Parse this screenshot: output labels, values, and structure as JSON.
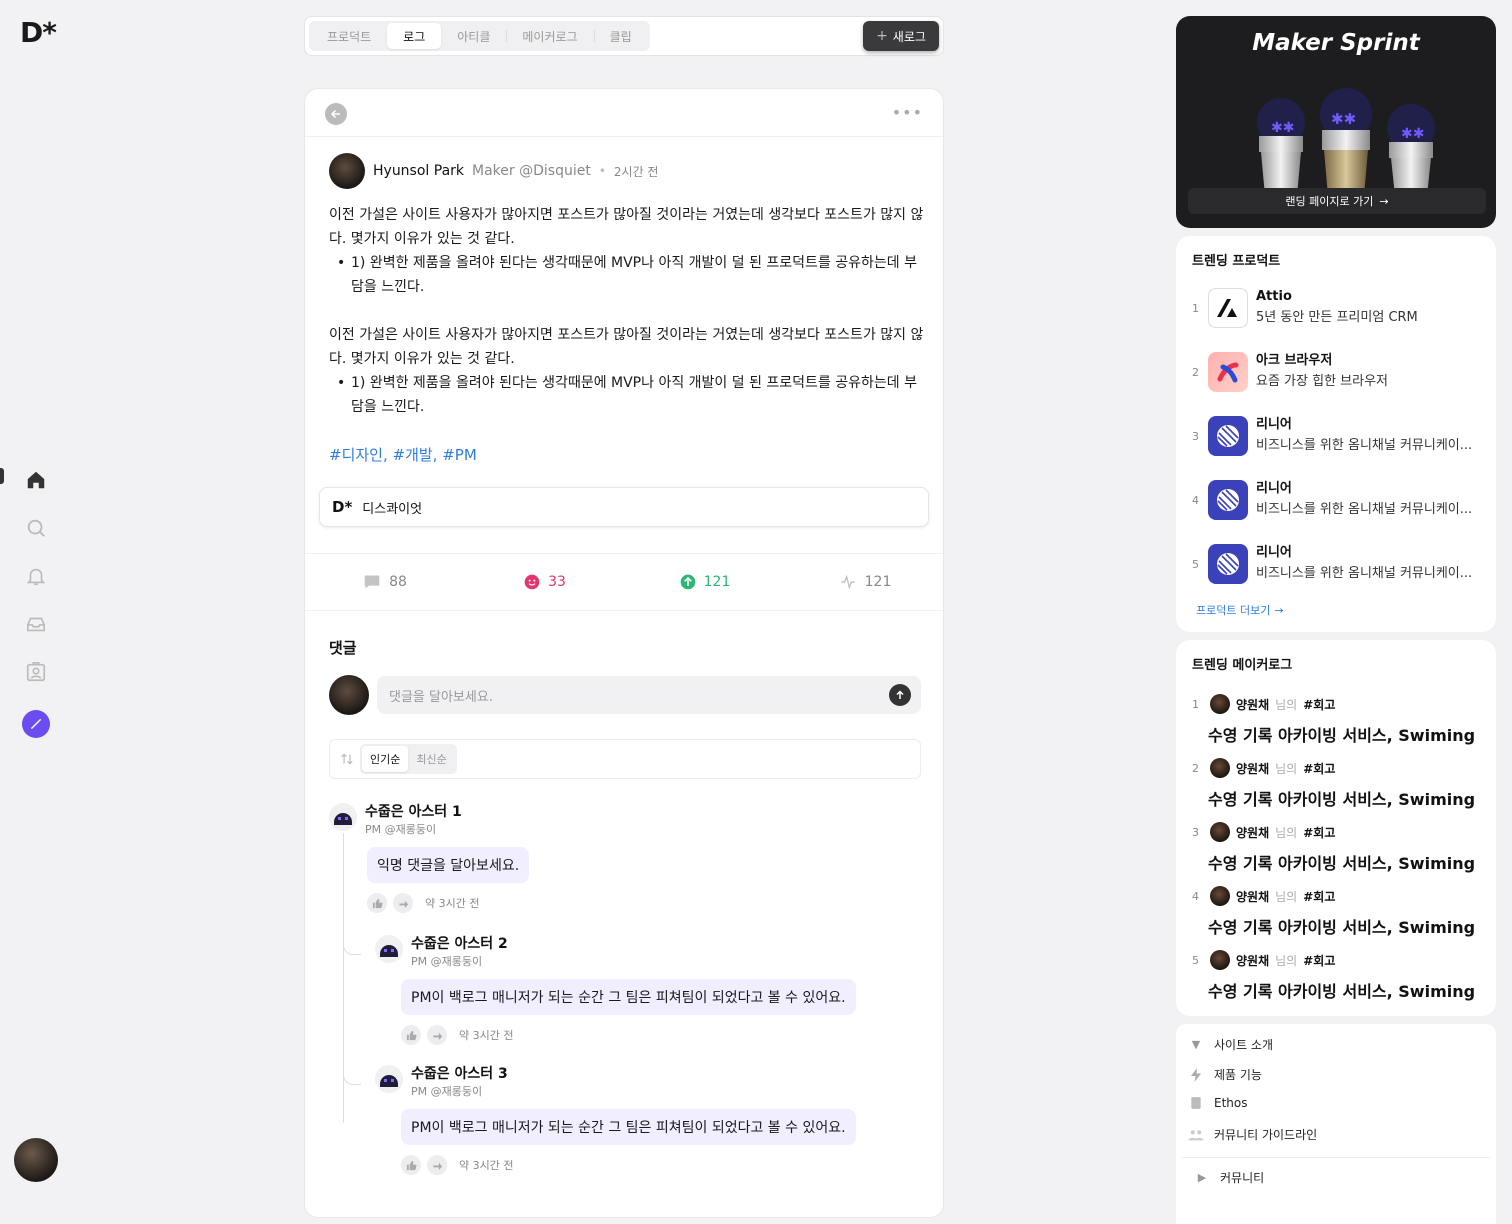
{
  "brand": {
    "logo": "D*"
  },
  "tabs": [
    {
      "label": "프로덕트"
    },
    {
      "label": "로그"
    },
    {
      "label": "아티클"
    },
    {
      "label": "메이커로그"
    },
    {
      "label": "클립"
    }
  ],
  "toolbar": {
    "new_label": "새로그"
  },
  "post": {
    "author_name": "Hyunsol Park",
    "author_role": "Maker @Disquiet",
    "time": "2시간 전",
    "para1": "이전 가설은 사이트 사용자가 많아지면 포스트가 많아질 것이라는 거였는데 생각보다 포스트가 많지 않다. 몇가지 이유가 있는 것 같다.",
    "bullet1": "1) 완벽한 제품을 올려야 된다는 생각때문에 MVP나 아직 개발이 덜 된 프로덕트를 공유하는데 부담을 느낀다.",
    "para2": "이전 가설은 사이트 사용자가 많아지면 포스트가 많아질 것이라는 거였는데 생각보다 포스트가 많지 않다. 몇가지 이유가 있는 것 같다.",
    "bullet2": "1) 완벽한 제품을 올려야 된다는 생각때문에 MVP나 아직 개발이 덜 된 프로덕트를 공유하는데 부담을 느낀다.",
    "tags": "#디자인, #개발, #PM",
    "embed_logo": "D*",
    "embed_name": "디스콰이엇",
    "stats": {
      "comments": "88",
      "reactions": "33",
      "upvotes": "121",
      "views": "121"
    }
  },
  "comments": {
    "title": "댓글",
    "placeholder": "댓글을 달아보세요.",
    "sort": {
      "popular": "인기순",
      "latest": "최신순"
    },
    "items": [
      {
        "name": "수줍은 아스터 1",
        "role": "PM @재롱둥이",
        "text": "익명 댓글을 달아보세요.",
        "time": "약 3시간 전"
      },
      {
        "name": "수줍은 아스터 2",
        "role": "PM @재롱둥이",
        "text": "PM이 백로그 매니저가 되는 순간 그 팀은 피쳐팀이 되었다고 볼 수 있어요.",
        "time": "약 3시간 전"
      },
      {
        "name": "수줍은 아스터 3",
        "role": "PM @재롱둥이",
        "text": "PM이 백로그 매니저가 되는 순간 그 팀은 피쳐팀이 되었다고 볼 수 있어요.",
        "time": "약 3시간 전"
      }
    ]
  },
  "banner": {
    "title": "Maker Sprint",
    "button": "랜딩 페이지로 가기"
  },
  "trending_products": {
    "title": "트렌딩 프로덕트",
    "items": [
      {
        "rank": "1",
        "name": "Attio",
        "desc": "5년 동안 만든 프리미엄 CRM",
        "icon": "attio-logo"
      },
      {
        "rank": "2",
        "name": "아크 브라우저",
        "desc": "요즘 가장 힙한 브라우저",
        "icon": "arc-logo"
      },
      {
        "rank": "3",
        "name": "리니어",
        "desc": "비즈니스를 위한 옴니채널 커뮤니케이...",
        "icon": "linear-logo"
      },
      {
        "rank": "4",
        "name": "리니어",
        "desc": "비즈니스를 위한 옴니채널 커뮤니케이...",
        "icon": "linear-logo"
      },
      {
        "rank": "5",
        "name": "리니어",
        "desc": "비즈니스를 위한 옴니채널 커뮤니케이...",
        "icon": "linear-logo"
      }
    ],
    "more": "프로덕트 더보기"
  },
  "trending_makerlogs": {
    "title": "트렌딩 메이커로그",
    "items": [
      {
        "rank": "1",
        "user": "양원채",
        "nim": "님의",
        "tag": "#회고",
        "title": "수영 기록 아카이빙 서비스, Swiming"
      },
      {
        "rank": "2",
        "user": "양원채",
        "nim": "님의",
        "tag": "#회고",
        "title": "수영 기록 아카이빙 서비스, Swiming"
      },
      {
        "rank": "3",
        "user": "양원채",
        "nim": "님의",
        "tag": "#회고",
        "title": "수영 기록 아카이빙 서비스, Swiming"
      },
      {
        "rank": "4",
        "user": "양원채",
        "nim": "님의",
        "tag": "#회고",
        "title": "수영 기록 아카이빙 서비스, Swiming"
      },
      {
        "rank": "5",
        "user": "양원채",
        "nim": "님의",
        "tag": "#회고",
        "title": "수영 기록 아카이빙 서비스, Swiming"
      }
    ]
  },
  "footer_nav": {
    "site_intro": "사이트 소개",
    "features": "제품 기능",
    "ethos": "Ethos",
    "guidelines": "커뮤니티 가이드라인",
    "community": "커뮤니티"
  },
  "colors": {
    "accent": "#6a4cf0",
    "link": "#2f7de1",
    "reaction": "#e0356f",
    "upvote": "#2bb673"
  }
}
